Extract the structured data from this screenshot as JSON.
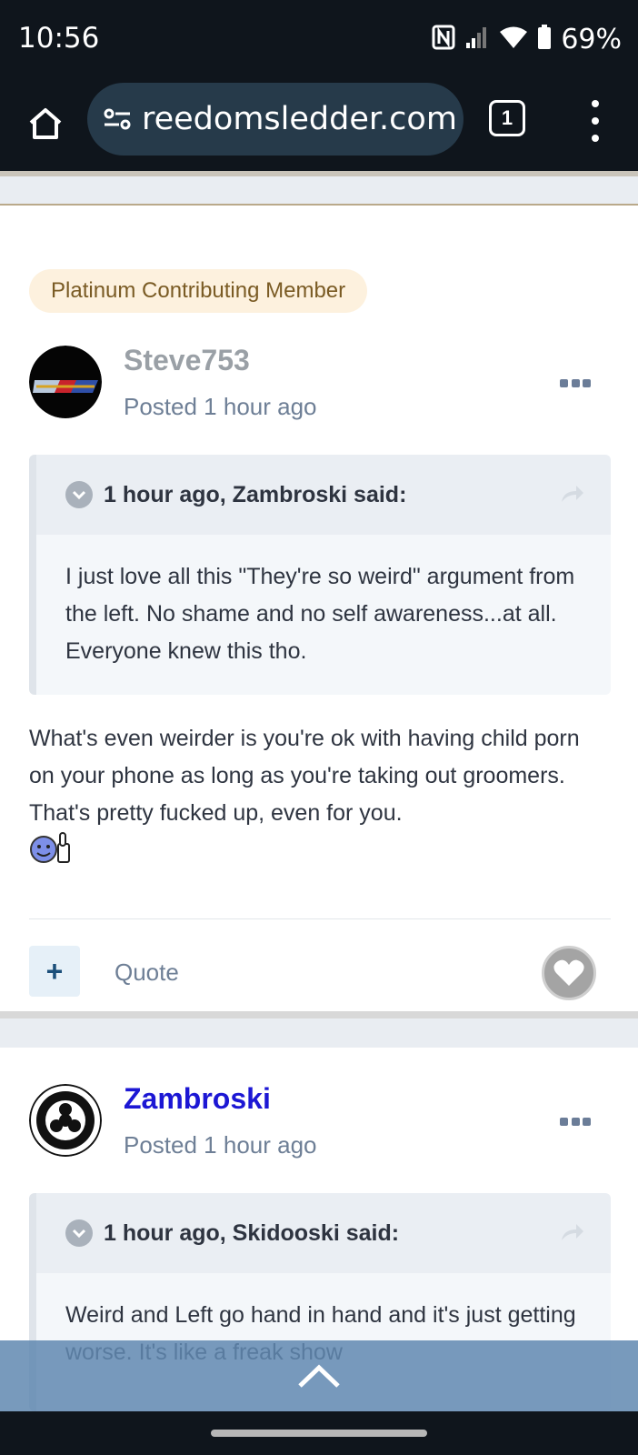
{
  "status": {
    "time": "10:56",
    "battery": "69%"
  },
  "browser": {
    "url": "reedomsledder.com",
    "tab_count": "1"
  },
  "posts": [
    {
      "badge": "Platinum Contributing Member",
      "author": "Steve753",
      "posted": "Posted 1 hour ago",
      "quote": {
        "title": "1 hour ago, Zambroski said:",
        "body": "I just love all this \"They're so weird\" argument from the left.  No shame and no self awareness...at all.  Everyone knew this tho."
      },
      "text": "What's even weirder is you're ok with having child porn on your phone as long as you're taking out groomers. That's pretty fucked up, even for you.",
      "plus_label": "+",
      "quote_label": "Quote"
    },
    {
      "author": "Zambroski",
      "posted": "Posted 1 hour ago",
      "quote": {
        "title": "1 hour ago, Skidooski said:",
        "body": "Weird and Left go hand in hand and it's just getting worse. It's like a freak show"
      }
    }
  ],
  "colors": {
    "author_link": "#1c17d4",
    "badge_bg": "#fdf1de",
    "scroll_btn": "#6088b0"
  }
}
